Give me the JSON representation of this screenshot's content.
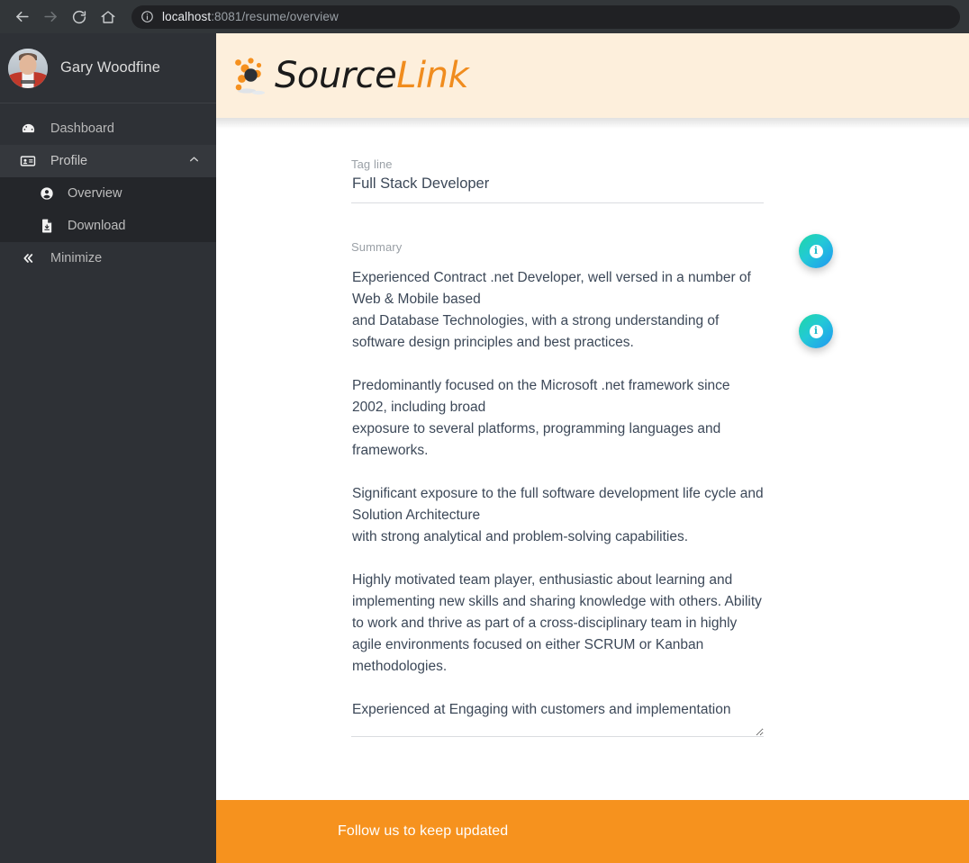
{
  "browser": {
    "back_icon": "arrow-left-icon",
    "forward_icon": "arrow-right-icon",
    "reload_icon": "reload-icon",
    "home_icon": "home-icon",
    "info_icon": "info-circle-icon",
    "url_host": "localhost",
    "url_path": ":8081/resume/overview",
    "url_full": "localhost:8081/resume/overview"
  },
  "sidebar": {
    "user": {
      "name": "Gary Woodfine",
      "avatar": "user-avatar"
    },
    "items": [
      {
        "label": "Dashboard",
        "icon": "tachometer-icon",
        "active": false
      },
      {
        "label": "Profile",
        "icon": "id-card-icon",
        "active": true,
        "chevron": "chevron-up-icon"
      }
    ],
    "submenu": [
      {
        "label": "Overview",
        "icon": "user-circle-icon"
      },
      {
        "label": "Download",
        "icon": "file-download-icon"
      }
    ],
    "minimize": {
      "label": "Minimize",
      "icon": "angle-double-left-icon"
    }
  },
  "header": {
    "logo_text_primary": "Source",
    "logo_text_secondary": "Link",
    "logo_mark": "dots-logo-icon",
    "background": "#fdefdc",
    "accent_orange": "#f08c1e"
  },
  "form": {
    "tagline": {
      "label": "Tag line",
      "value": "Full Stack Developer",
      "placeholder": "Tag line"
    },
    "summary": {
      "label": "Summary",
      "value": "Experienced Contract .net Developer, well versed in a number of Web & Mobile based\nand Database Technologies, with a strong understanding of software design principles and best practices.\n\nPredominantly focused on the Microsoft .net framework since 2002, including broad\nexposure to several platforms, programming languages and frameworks.\n\nSignificant exposure to the full software development life cycle and Solution Architecture\nwith strong analytical and problem-solving capabilities.\n\nHighly motivated team player, enthusiastic about learning and implementing new skills and sharing knowledge with others. Ability to work and thrive as part of a cross-disciplinary team in highly agile environments focused on either SCRUM or Kanban methodologies.\n\nExperienced at Engaging with customers and implementation",
      "placeholder": "Summary"
    }
  },
  "fabs": [
    {
      "name": "info-button-tagline",
      "icon": "info-icon",
      "glyph": "i"
    },
    {
      "name": "info-button-summary",
      "icon": "info-icon",
      "glyph": "i"
    }
  ],
  "footer": {
    "text": "Follow us to keep updated",
    "background": "#f6921e"
  }
}
